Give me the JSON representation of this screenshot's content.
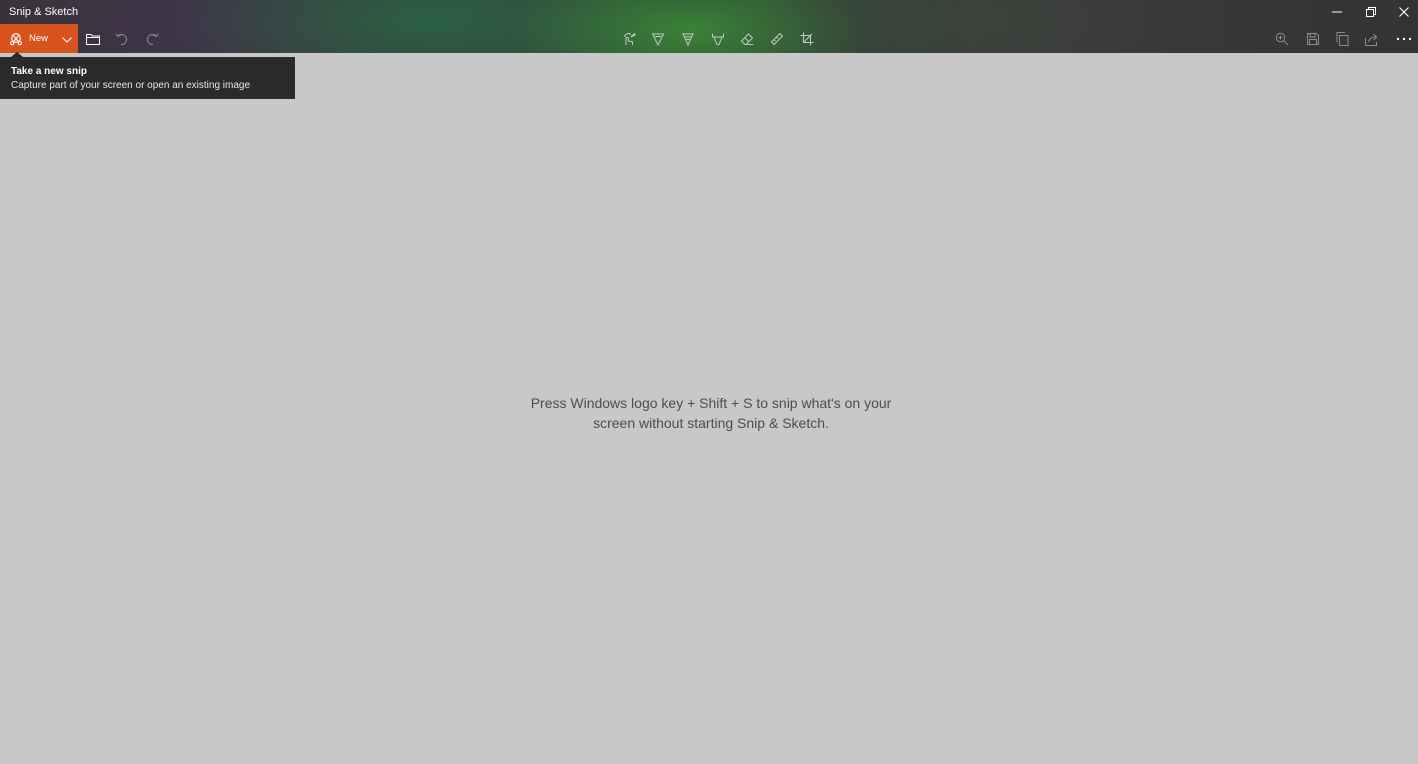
{
  "window": {
    "title": "Snip & Sketch",
    "controls": {
      "minimize_icon": "minimize-icon",
      "restore_icon": "restore-icon",
      "close_icon": "close-icon"
    }
  },
  "toolbar": {
    "new_label": "New",
    "new_icon": "snip-icon",
    "dropdown_icon": "chevron-down-icon",
    "left_tools": [
      "folder-open-icon",
      "undo-icon",
      "redo-icon"
    ],
    "center_tools": [
      "touch-writing-icon",
      "ballpoint-pen-icon",
      "pencil-icon",
      "highlighter-icon",
      "eraser-icon",
      "ruler-icon",
      "crop-icon"
    ],
    "right_tools": [
      "zoom-icon",
      "save-icon",
      "copy-icon",
      "share-icon",
      "more-icon"
    ],
    "accent_color": "#d9531e"
  },
  "tooltip": {
    "title": "Take a new snip",
    "description": "Capture part of your screen or open an existing image"
  },
  "canvas": {
    "hint_line1": "Press Windows logo key + Shift + S to snip what's on your",
    "hint_line2": "screen without starting Snip & Sketch."
  }
}
